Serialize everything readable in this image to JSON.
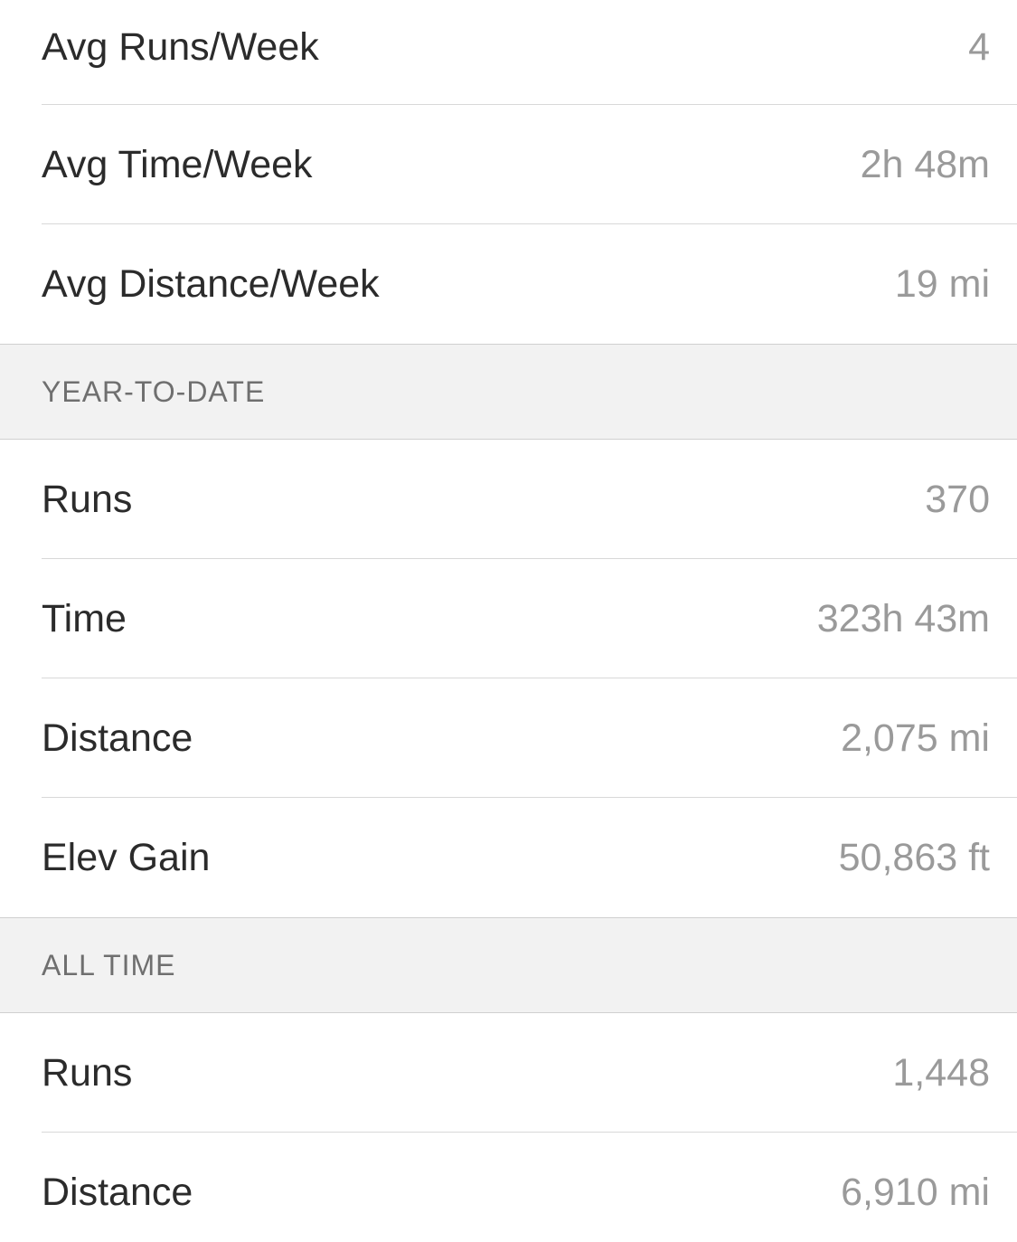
{
  "weekly_stats": [
    {
      "label": "Avg Runs/Week",
      "value": "4"
    },
    {
      "label": "Avg Time/Week",
      "value": "2h 48m"
    },
    {
      "label": "Avg Distance/Week",
      "value": "19 mi"
    }
  ],
  "year_to_date": {
    "title": "YEAR-TO-DATE",
    "rows": [
      {
        "label": "Runs",
        "value": "370"
      },
      {
        "label": "Time",
        "value": "323h 43m"
      },
      {
        "label": "Distance",
        "value": "2,075 mi"
      },
      {
        "label": "Elev Gain",
        "value": "50,863 ft"
      }
    ]
  },
  "all_time": {
    "title": "ALL TIME",
    "rows": [
      {
        "label": "Runs",
        "value": "1,448"
      },
      {
        "label": "Distance",
        "value": "6,910 mi"
      }
    ]
  },
  "colors": {
    "label": "#2b2b2b",
    "value": "#9a9a9a",
    "section_background": "#f2f2f2",
    "section_title": "#6f6f6f",
    "separator": "#d8d8d8"
  }
}
